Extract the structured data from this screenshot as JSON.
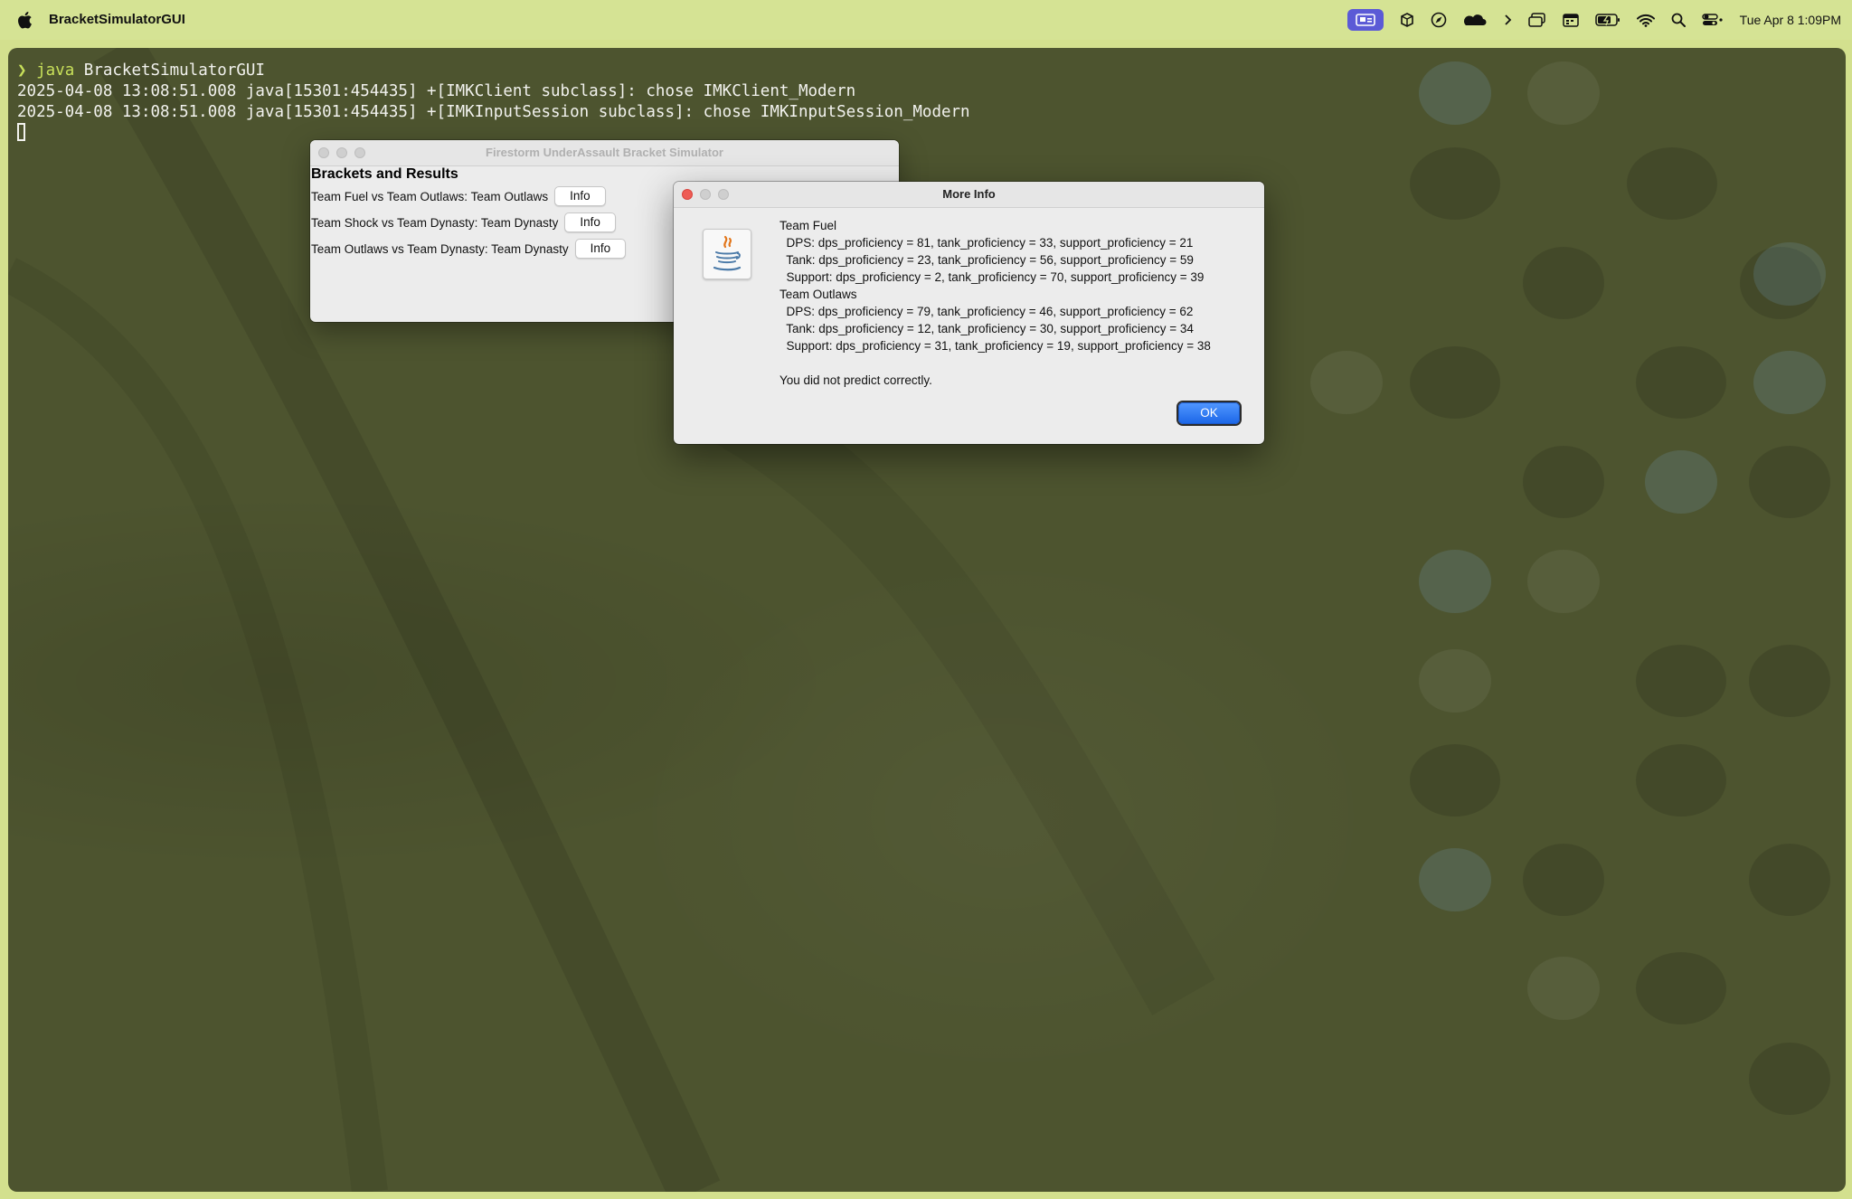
{
  "menubar": {
    "app_name": "BracketSimulatorGUI",
    "clock": "Tue Apr 8  1:09PM",
    "tray_icons": [
      "screen-share-icon",
      "box-icon",
      "compass-icon",
      "cloud-icon",
      "chevron-right-icon",
      "window-icon",
      "calendar-icon",
      "battery-icon",
      "wifi-icon",
      "search-icon",
      "control-center-icon"
    ]
  },
  "terminal": {
    "prompt_symbol": "❯",
    "command_java": "java",
    "command_rest": " BracketSimulatorGUI",
    "log_line_1": "2025-04-08 13:08:51.008 java[15301:454435] +[IMKClient subclass]: chose IMKClient_Modern",
    "log_line_2": "2025-04-08 13:08:51.008 java[15301:454435] +[IMKInputSession subclass]: chose IMKInputSession_Modern"
  },
  "bracket_window": {
    "title": "Firestorm UnderAssault Bracket Simulator",
    "heading": "Brackets and Results",
    "rows": [
      {
        "text": "Team Fuel vs Team Outlaws: Team Outlaws",
        "button": "Info"
      },
      {
        "text": "Team Shock vs Team Dynasty: Team Dynasty",
        "button": "Info"
      },
      {
        "text": "Team Outlaws vs Team Dynasty: Team Dynasty",
        "button": "Info"
      }
    ]
  },
  "dialog": {
    "title": "More Info",
    "lines": [
      "Team Fuel",
      "  DPS: dps_proficiency = 81, tank_proficiency = 33, support_proficiency = 21",
      "  Tank: dps_proficiency = 23, tank_proficiency = 56, support_proficiency = 59",
      "  Support: dps_proficiency = 2, tank_proficiency = 70, support_proficiency = 39",
      "Team Outlaws",
      "  DPS: dps_proficiency = 79, tank_proficiency = 46, support_proficiency = 62",
      "  Tank: dps_proficiency = 12, tank_proficiency = 30, support_proficiency = 34",
      "  Support: dps_proficiency = 31, tank_proficiency = 19, support_proficiency = 38",
      "",
      "You did not predict correctly."
    ],
    "ok_label": "OK"
  }
}
